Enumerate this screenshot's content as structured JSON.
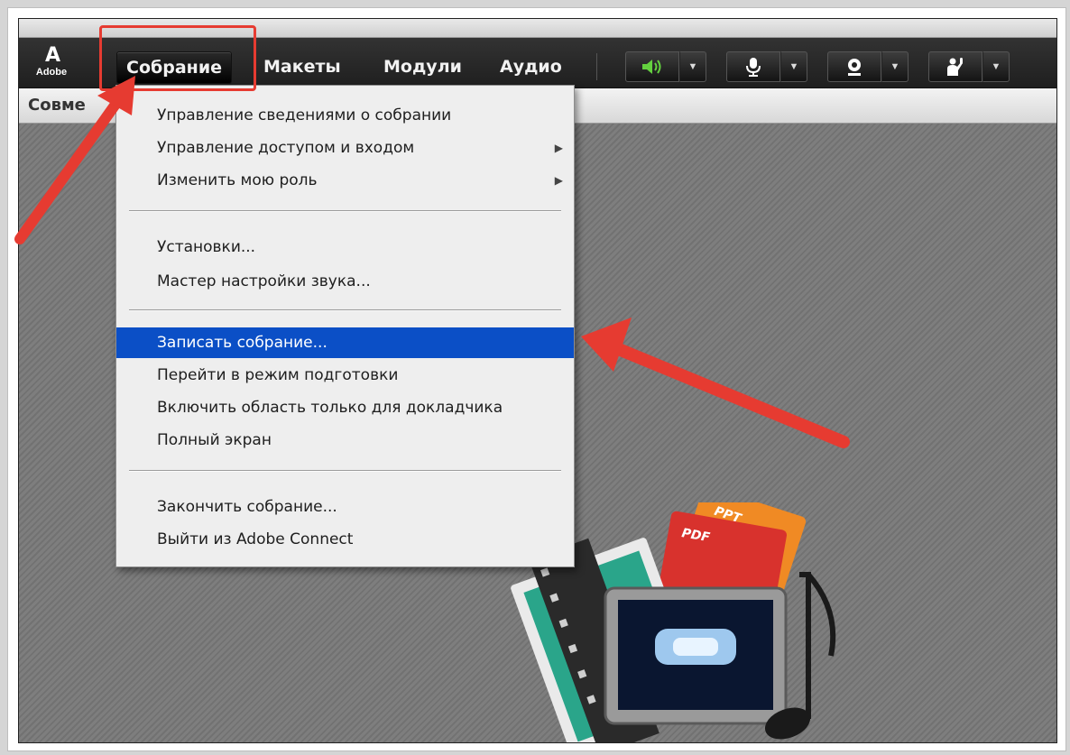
{
  "app": {
    "brand": "Adobe",
    "logo_mark": "A"
  },
  "menubar": {
    "items": [
      {
        "label": "Собрание"
      },
      {
        "label": "Макеты"
      },
      {
        "label": "Модули"
      },
      {
        "label": "Аудио"
      }
    ]
  },
  "toolbar": {
    "buttons": [
      {
        "icon": "speaker-icon",
        "glyph": "🔊"
      },
      {
        "icon": "microphone-icon",
        "glyph": "🎙"
      },
      {
        "icon": "webcam-icon",
        "glyph": "◉"
      },
      {
        "icon": "raise-hand-icon",
        "glyph": "✋"
      }
    ],
    "dropdown_glyph": "▼"
  },
  "pod": {
    "title_visible": "Совме"
  },
  "dropdown_menu": {
    "groups": [
      [
        {
          "label": "Управление сведениями о собрании",
          "submenu": false
        },
        {
          "label": "Управление доступом и входом",
          "submenu": true
        },
        {
          "label": "Изменить мою роль",
          "submenu": true
        }
      ],
      [
        {
          "label": "Установки...",
          "submenu": false
        },
        {
          "label": "Мастер настройки звука...",
          "submenu": false
        }
      ],
      [
        {
          "label": "Записать собрание...",
          "submenu": false,
          "highlighted": true
        },
        {
          "label": "Перейти в режим подготовки",
          "submenu": false
        },
        {
          "label": "Включить область только для докладчика",
          "submenu": false
        },
        {
          "label": "Полный экран",
          "submenu": false
        }
      ],
      [
        {
          "label": "Закончить собрание...",
          "submenu": false
        },
        {
          "label": "Выйти из Adobe Connect",
          "submenu": false
        }
      ]
    ],
    "submenu_glyph": "▶"
  },
  "media_art": {
    "ppt_label": "PPT",
    "pdf_label": "PDF"
  },
  "colors": {
    "highlight": "#0b4fc6",
    "annotation": "#e63b31",
    "speaker_active": "#64d13f"
  }
}
